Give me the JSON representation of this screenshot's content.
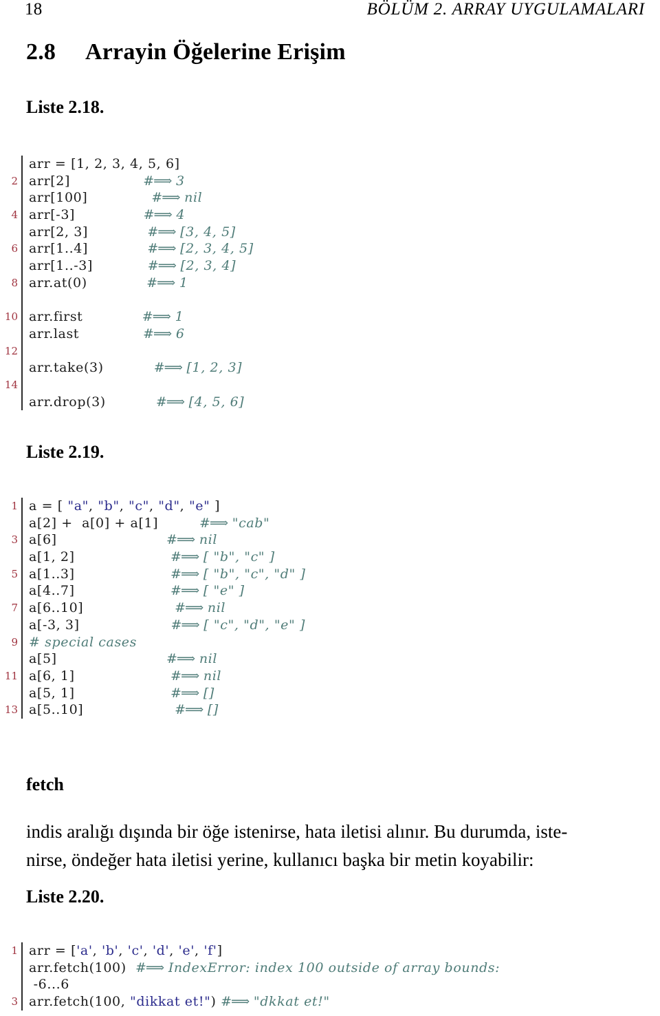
{
  "header": {
    "page_number": "18",
    "running_title": "BÖLÜM 2.  ARRAY UYGULAMALARI"
  },
  "section": {
    "number": "2.8",
    "title": "Arrayin Öğelerine Erişim"
  },
  "captions": {
    "liste_218": "Liste 2.18.",
    "liste_219": "Liste 2.19.",
    "liste_220": "Liste 2.20."
  },
  "subheading": {
    "fetch": "fetch"
  },
  "paragraph": {
    "line1": "indis aralığı dışında bir öğe istenirse, hata iletisi alınır. Bu durumda, iste-",
    "line2": "nirse, öndeğer hata iletisi yerine, kullanıcı başka bir metin koyabilir:"
  },
  "colors": {
    "line_number": "#a03440",
    "string": "#2b2b8c",
    "comment": "#4f7c78",
    "code": "#1a1a1a",
    "rule": "#2b2b2b"
  },
  "listing_218": {
    "lines": [
      {
        "no": "",
        "code": "arr = [1, 2, 3, 4, 5, 6]",
        "comment": ""
      },
      {
        "no": "2",
        "code": "arr[2]",
        "comment": "#=> 3"
      },
      {
        "no": "",
        "code": "arr[100]",
        "comment": "#=> nil"
      },
      {
        "no": "4",
        "code": "arr[-3]",
        "comment": "#=> 4"
      },
      {
        "no": "",
        "code": "arr[2, 3]",
        "comment": "#=> [3, 4, 5]"
      },
      {
        "no": "6",
        "code": "arr[1..4]",
        "comment": "#=> [2, 3, 4, 5]"
      },
      {
        "no": "",
        "code": "arr[1..-3]",
        "comment": "#=> [2, 3, 4]"
      },
      {
        "no": "8",
        "code": "arr.at(0)",
        "comment": "#=> 1"
      },
      {
        "no": "",
        "code": "",
        "comment": ""
      },
      {
        "no": "10",
        "code": "arr.first",
        "comment": "#=> 1"
      },
      {
        "no": "",
        "code": "arr.last",
        "comment": "#=> 6"
      },
      {
        "no": "12",
        "code": "",
        "comment": ""
      },
      {
        "no": "",
        "code": "arr.take(3)",
        "comment": "#=> [1, 2, 3]"
      },
      {
        "no": "14",
        "code": "",
        "comment": ""
      },
      {
        "no": "",
        "code": "arr.drop(3)",
        "comment": "#=> [4, 5, 6]"
      }
    ]
  },
  "listing_219": {
    "lines": [
      {
        "no": "1",
        "code": "a = [ \"a\", \"b\", \"c\", \"d\", \"e\" ]",
        "comment": "",
        "string_code": true
      },
      {
        "no": "",
        "code": "a[2] +  a[0] + a[1]",
        "comment": "#=> \"cab\""
      },
      {
        "no": "3",
        "code": "a[6]",
        "comment": "#=> nil"
      },
      {
        "no": "",
        "code": "a[1, 2]",
        "comment": "#=> [ \"b\", \"c\" ]"
      },
      {
        "no": "5",
        "code": "a[1..3]",
        "comment": "#=> [ \"b\", \"c\", \"d\" ]"
      },
      {
        "no": "",
        "code": "a[4..7]",
        "comment": "#=> [ \"e\" ]"
      },
      {
        "no": "7",
        "code": "a[6..10]",
        "comment": "#=> nil"
      },
      {
        "no": "",
        "code": "a[-3, 3]",
        "comment": "#=> [ \"c\", \"d\", \"e\" ]"
      },
      {
        "no": "9",
        "code": "",
        "comment": "# special cases",
        "comment_only": true
      },
      {
        "no": "",
        "code": "a[5]",
        "comment": "#=> nil"
      },
      {
        "no": "11",
        "code": "a[6, 1]",
        "comment": "#=> nil"
      },
      {
        "no": "",
        "code": "a[5, 1]",
        "comment": "#=> []"
      },
      {
        "no": "13",
        "code": "a[5..10]",
        "comment": "#=> []"
      }
    ]
  },
  "listing_220": {
    "lines": [
      {
        "no": "1",
        "code": "arr = ['a', 'b', 'c', 'd', 'e', 'f']",
        "comment": ""
      },
      {
        "no": "",
        "code": "arr.fetch(100)",
        "comment": "#=> IndexError: index 100 outside of array bounds:"
      },
      {
        "no": "",
        "code": " -6...6",
        "comment": "",
        "continuation": true
      },
      {
        "no": "3",
        "code": "arr.fetch(100, \"dikkat et!\")",
        "comment": "#=> \"dkkat et!\""
      }
    ]
  }
}
